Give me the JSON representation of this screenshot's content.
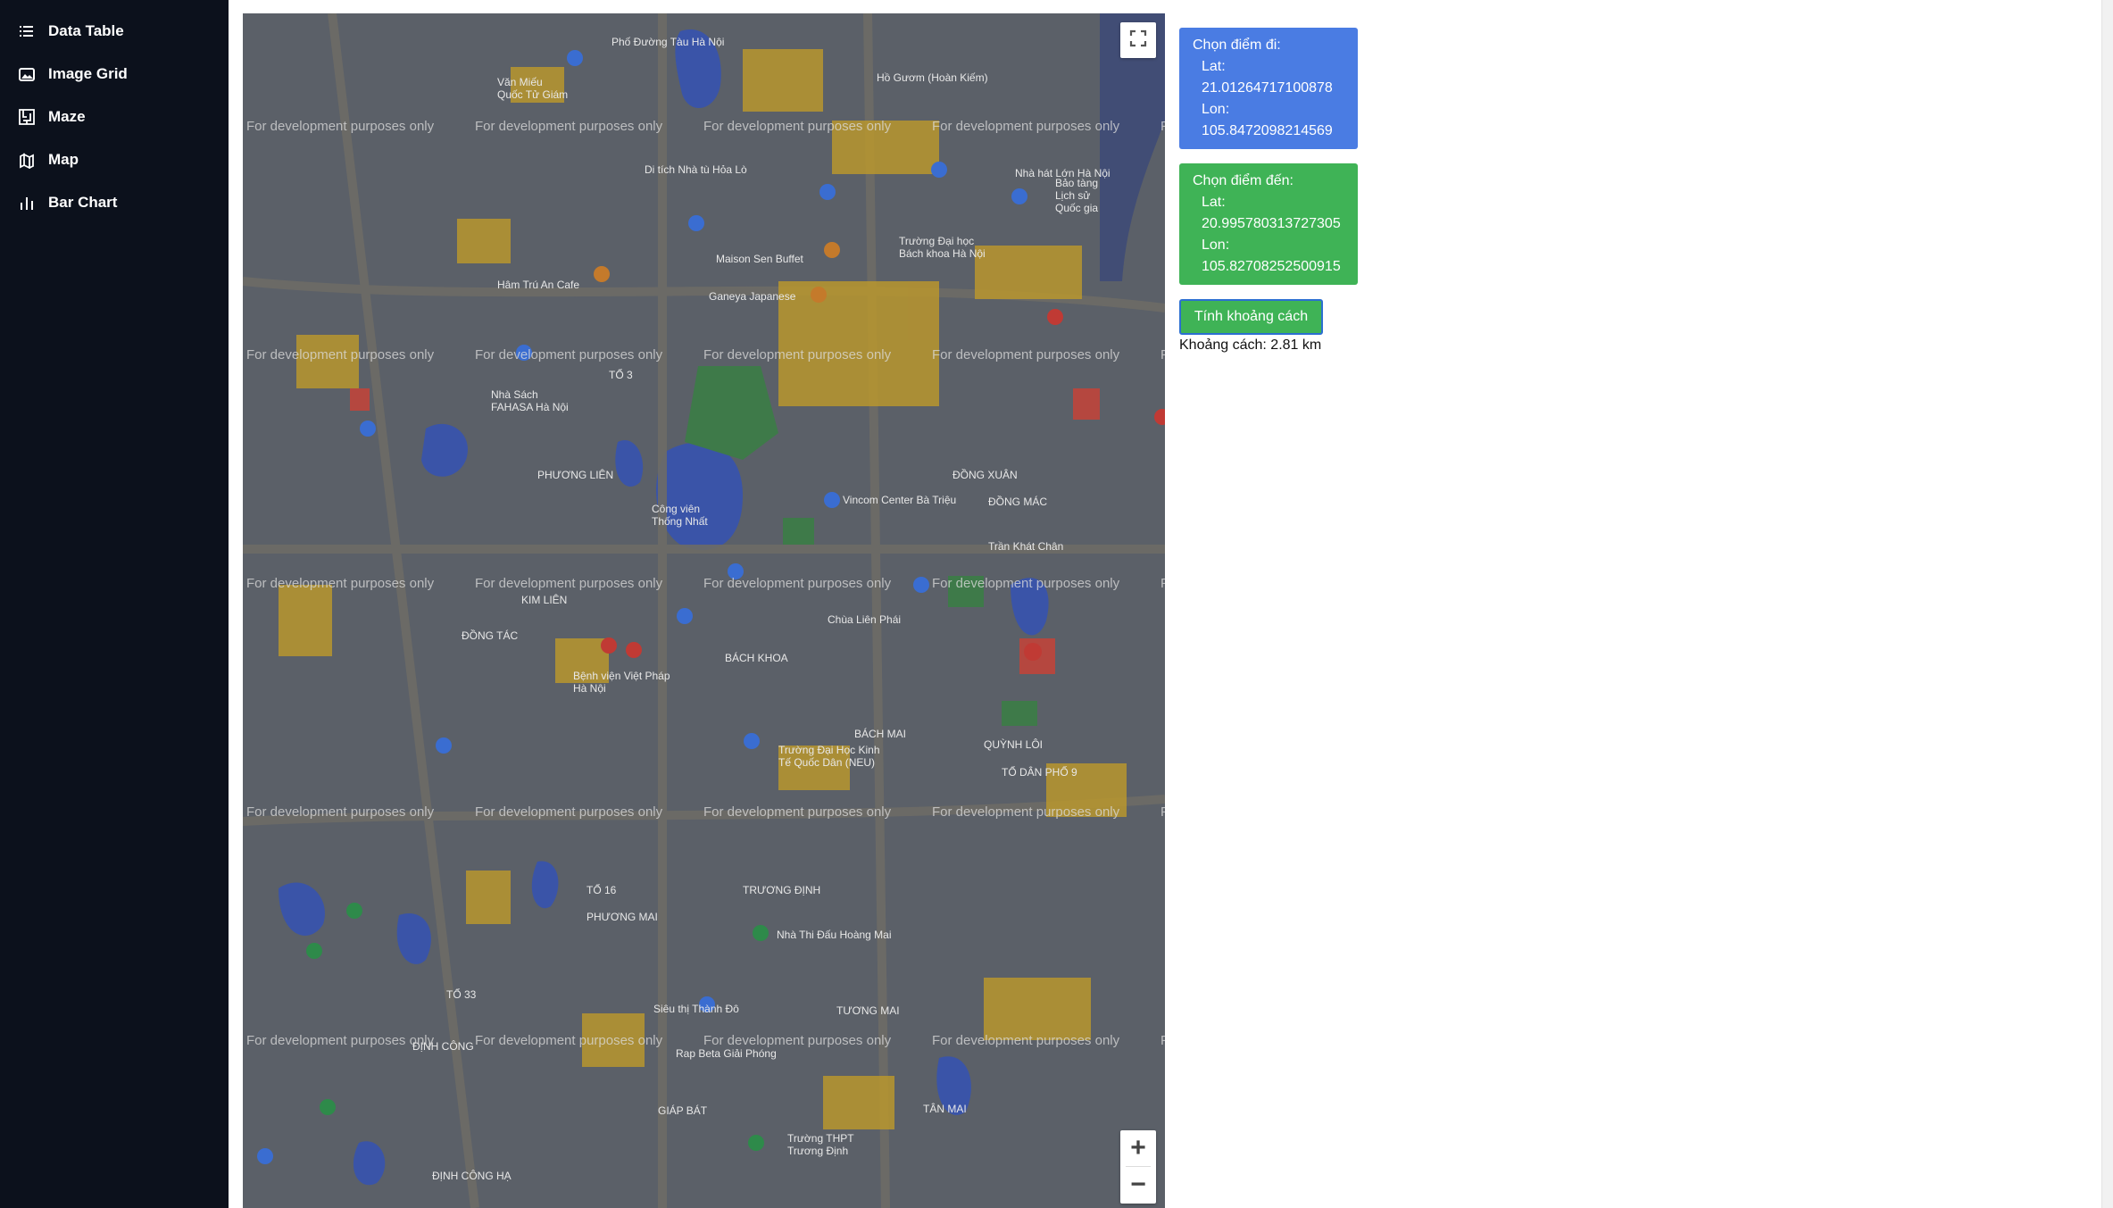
{
  "sidebar": {
    "items": [
      {
        "label": "Data Table",
        "icon": "list-icon"
      },
      {
        "label": "Image Grid",
        "icon": "image-grid-icon"
      },
      {
        "label": "Maze",
        "icon": "maze-icon"
      },
      {
        "label": "Map",
        "icon": "map-icon"
      },
      {
        "label": "Bar Chart",
        "icon": "bar-chart-icon"
      }
    ]
  },
  "map": {
    "watermark": "For development purposes only",
    "zoom_in_label": "+",
    "zoom_out_label": "−",
    "labels": {
      "vietnam_tax": "Phố Đường Tàu Hà Nội",
      "hoan_kiem": "Hồ Gươm (Hoàn Kiếm)",
      "nha_hat": "Nhà hát Lớn Hà Nội",
      "bao_tang": "Bảo tàng Lịch sử Quốc gia",
      "van_mieu": "Văn Miếu Quốc Tử Giám",
      "hoa_lo": "Di tích Nhà tù Hỏa Lò",
      "maison": "Maison Sen Buffet",
      "ganeya": "Ganeya Japanese",
      "truong_dai_hoc": "Trường Đại học Bách khoa Hà Nội",
      "ham_tru_an": "Hâm Trú An Cafe",
      "to3": "TỔ 3",
      "nha_sach": "Nhà Sách FAHASA Hà Nội",
      "phuong_lien": "PHƯƠNG LIÊN",
      "cong_vien": "Công viên Thống Nhất",
      "vincom": "Vincom Center Bà Triệu",
      "dong_xuan": "ĐỒNG XUÂN",
      "dong_mac": "ĐỒNG MÁC",
      "tran_khat_chan": "Trần Khát Chân",
      "dong_tac": "ĐỒNG TÁC",
      "kim_lien": "KIM LIÊN",
      "benh_vien_viet_phap": "Bệnh viện Việt Pháp Hà Nội",
      "chua_lien_phai": "Chùa Liên Phái",
      "bach_khoa": "BÁCH KHOA",
      "bach_mai": "BÁCH MAI",
      "quynh_loi": "QUỲNH LÔI",
      "to_dan_pho_9": "TỔ DÂN PHỐ 9",
      "dh_kinh_te": "Trường Đại Học Kinh Tế Quốc Dân (NEU)",
      "truong_dinh": "TRƯƠNG ĐỊNH",
      "to16": "TỔ 16",
      "phuong_mai": "PHƯƠNG MAI",
      "tuong_mai": "TƯƠNG MAI",
      "to33": "TỔ 33",
      "dinh_cong": "ĐỊNH CÔNG",
      "giap_bat": "GIÁP BÁT",
      "tan_mai": "TÂN MAI",
      "sieu_thi": "Siêu thị Thành Đô",
      "rap_beta": "Rap Beta Giải Phóng",
      "truong_thpt": "Trường THPT Trương Định",
      "dinh_cong_ha": "ĐỊNH CÔNG HẠ",
      "nha_thi_dau": "Nhà Thi Đấu Hoàng Mai"
    }
  },
  "panel": {
    "start": {
      "title": "Chọn điểm đi:",
      "lat": "Lat: 21.01264717100878",
      "lon": "Lon: 105.8472098214569"
    },
    "end": {
      "title": "Chọn điểm đến:",
      "lat": "Lat: 20.995780313727305",
      "lon": "Lon: 105.82708252500915"
    },
    "calc_button": "Tính khoảng cách",
    "result": "Khoảng cách: 2.81 km"
  },
  "colors": {
    "sidebar_bg": "#0c111c",
    "start_card": "#4a7ce3",
    "end_card": "#3fb356",
    "map_base": "#5a5f66",
    "map_road_major": "#c9a63a"
  }
}
